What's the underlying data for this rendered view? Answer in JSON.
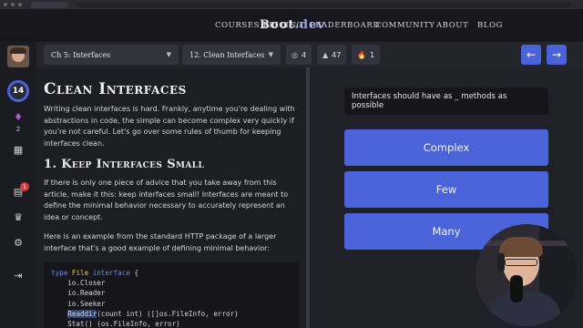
{
  "brand": {
    "main": "Boot",
    "suffix": ".dev"
  },
  "nav": {
    "links": [
      "Courses",
      "Pricing",
      "Leaderboard",
      "Community",
      "About",
      "Blog"
    ]
  },
  "toolbar": {
    "chapter": "Ch 5: Interfaces",
    "lesson": "12. Clean Interfaces",
    "badges": [
      {
        "icon": "target-icon",
        "glyph": "◎",
        "count": "4"
      },
      {
        "icon": "warning-icon",
        "glyph": "▲",
        "count": "47"
      },
      {
        "icon": "flame-icon",
        "glyph": "🔥",
        "count": "1"
      }
    ],
    "prev_glyph": "←",
    "next_glyph": "→"
  },
  "sidebar": {
    "level": "14",
    "gems": "2",
    "notifications": "1"
  },
  "lesson": {
    "title": "Clean Interfaces",
    "intro": "Writing clean interfaces is hard. Frankly, anytime you're dealing with abstractions in code, the simple can become complex very quickly if you're not careful. Let's go over some rules of thumb for keeping interfaces clean.",
    "section_title": "1. Keep Interfaces Small",
    "p1": "If there is only one piece of advice that you take away from this article, make it this: keep interfaces small! Interfaces are meant to define the minimal behavior necessary to accurately represent an idea or concept.",
    "p2": "Here is an example from the standard HTTP package of a larger interface that's a good example of defining minimal behavior:",
    "code": {
      "line1_kw": "type",
      "line1_name": "File",
      "line1_kw2": "interface",
      "line1_brace": "{",
      "line2": "    io.Closer",
      "line3": "    io.Reader",
      "line4": "    io.Seeker",
      "line5_indent": "    ",
      "line5_hl": "Readdir",
      "line5_rest": "(count int) ([]os.FileInfo, error)",
      "line6": "    Stat() (os.FileInfo, error)",
      "line7": "}"
    }
  },
  "quiz": {
    "question": "Interfaces should have as _ methods as possible",
    "answers": [
      "Complex",
      "Few",
      "Many"
    ]
  },
  "colors": {
    "accent": "#4b63d8",
    "background": "#1b1b22",
    "keyword": "#6a8ff0"
  }
}
